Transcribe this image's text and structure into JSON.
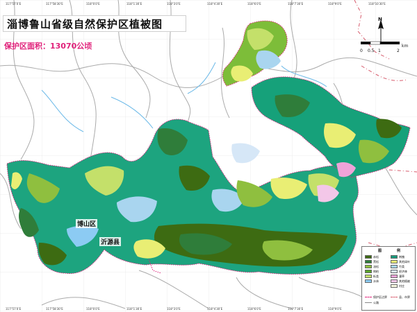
{
  "title": "淄博鲁山省级自然保护区植被图",
  "area_label": "保护区面积：13070公顷",
  "places": {
    "boshan": "博山区",
    "yiyuan": "沂源县"
  },
  "compass": {
    "north": "N",
    "icon": "north-arrow-icon"
  },
  "scale": {
    "labels": [
      "0",
      "0.5",
      "1",
      "2"
    ],
    "unit": "km"
  },
  "coordinates": {
    "top": [
      "117°57′0″E",
      "117°58′30″E",
      "118°0′0″E",
      "118°1′30″E",
      "118°3′0″E",
      "118°4′30″E",
      "118°6′0″E",
      "118°7′30″E",
      "118°9′0″E",
      "118°10′30″E"
    ],
    "bottom": [
      "117°57′0″E",
      "117°58′30″E",
      "118°0′0″E",
      "118°1′30″E",
      "118°3′0″E",
      "118°4′30″E",
      "118°6′0″E",
      "118°7′30″E",
      "118°9′0″E",
      "118°10′30″E"
    ]
  },
  "legend": {
    "title_left": "图",
    "title_right": "例",
    "items": [
      {
        "label": "赤松",
        "color": "#3d6b12"
      },
      {
        "label": "黑松",
        "color": "#2f7d3a"
      },
      {
        "label": "油松",
        "color": "#8fbf3f"
      },
      {
        "label": "侧柏",
        "color": "#5aa52a"
      },
      {
        "label": "栎类",
        "color": "#c4e06a"
      },
      {
        "label": "刺槐",
        "color": "#169a7c"
      },
      {
        "label": "其他阔叶",
        "color": "#e9ee74"
      },
      {
        "label": "竹类",
        "color": "#a9d5ef"
      },
      {
        "label": "经济林",
        "color": "#d6e7f7"
      },
      {
        "label": "灌草",
        "color": "#efa3d8"
      },
      {
        "label": "其他植被",
        "color": "#f3c7e8"
      },
      {
        "label": "水体",
        "color": "#8ccbf3"
      },
      {
        "label": "村庄",
        "color": "#f6f6e0"
      }
    ],
    "lines": [
      {
        "label": "保护区边界",
        "color": "#e0217a"
      },
      {
        "label": "县、市界",
        "color": "#d75b6c"
      },
      {
        "label": "公路",
        "color": "#888888"
      }
    ]
  },
  "colors": {
    "boundary": "#e0217a",
    "road": "#a7a7a7",
    "water": "#6bb9e8"
  }
}
